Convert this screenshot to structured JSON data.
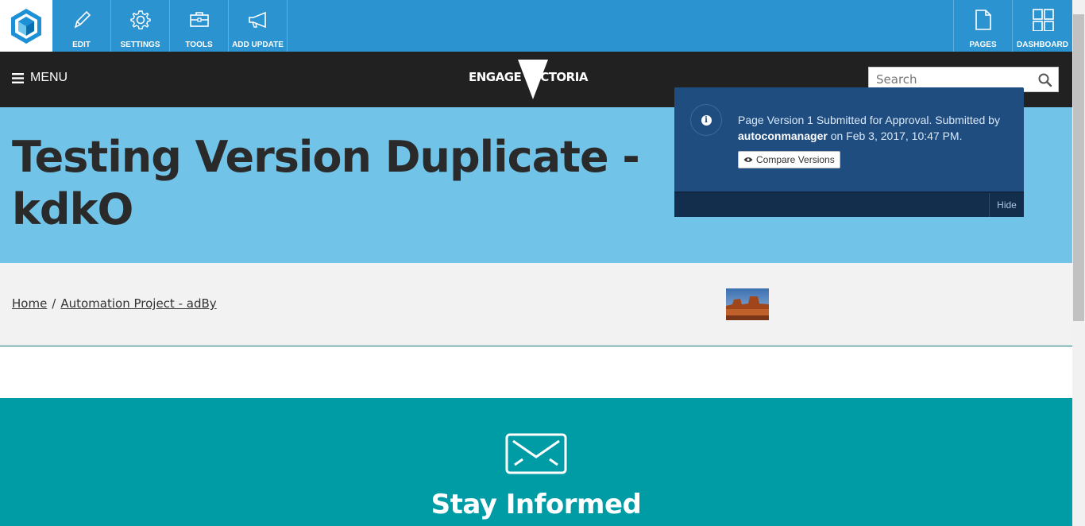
{
  "toolbar": {
    "buttons": [
      {
        "label": "EDIT",
        "icon": "pencil-icon"
      },
      {
        "label": "SETTINGS",
        "icon": "gear-icon"
      },
      {
        "label": "TOOLS",
        "icon": "toolbox-icon"
      },
      {
        "label": "ADD UPDATE",
        "icon": "megaphone-icon"
      }
    ],
    "right_buttons": [
      {
        "label": "PAGES",
        "icon": "page-icon"
      },
      {
        "label": "DASHBOARD",
        "icon": "dashboard-grid-icon"
      }
    ]
  },
  "header": {
    "menu_label": "MENU",
    "brand_left": "ENGAGE",
    "brand_right": "VICTORIA",
    "search_placeholder": "Search"
  },
  "hero": {
    "title": "Testing Version Duplicate - kdkO"
  },
  "notice": {
    "message_prefix": "Page Version 1 Submitted for Approval. Submitted by ",
    "user": "autoconmanager",
    "message_suffix": " on Feb 3, 2017, 10:47 PM.",
    "compare_label": "Compare Versions",
    "hide_label": "Hide"
  },
  "breadcrumb": {
    "home": "Home",
    "separator": "/",
    "project": "Automation Project - adBy"
  },
  "stay": {
    "title": "Stay Informed"
  },
  "colors": {
    "toolbar": "#2b93d0",
    "header": "#212121",
    "hero": "#71c3e8",
    "notice": "#1f4d80",
    "stay": "#009ca6"
  }
}
